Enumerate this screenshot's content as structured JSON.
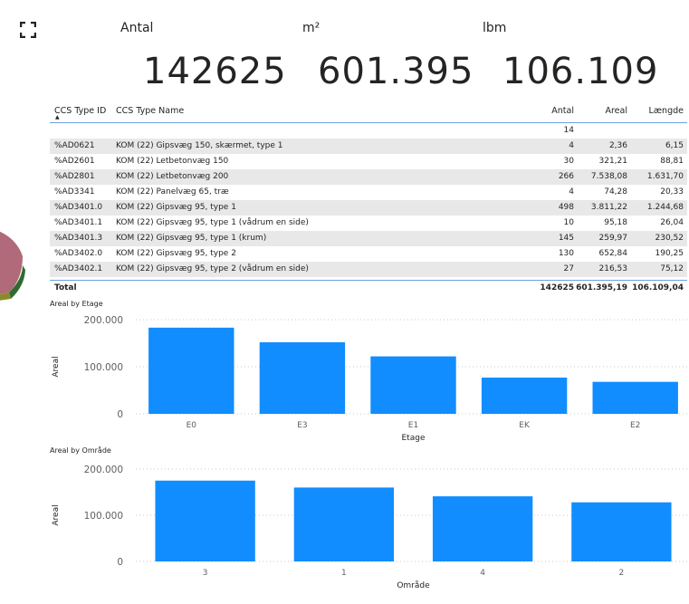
{
  "focus_icon": "focus-mode-icon",
  "kpis": [
    {
      "label": "Antal",
      "value": "142625"
    },
    {
      "label": "m²",
      "value": "601.395"
    },
    {
      "label": "lbm",
      "value": "106.109"
    }
  ],
  "table": {
    "headers": [
      "CCS Type ID",
      "CCS Type Name",
      "Antal",
      "Areal",
      "Længde"
    ],
    "rows": [
      [
        "",
        "",
        "14",
        "",
        ""
      ],
      [
        "%AD0621",
        "KOM (22) Gipsvæg 150, skærmet, type 1",
        "4",
        "2,36",
        "6,15"
      ],
      [
        "%AD2601",
        "KOM (22) Letbetonvæg 150",
        "30",
        "321,21",
        "88,81"
      ],
      [
        "%AD2801",
        "KOM (22) Letbetonvæg 200",
        "266",
        "7.538,08",
        "1.631,70"
      ],
      [
        "%AD3341",
        "KOM (22) Panelvæg 65, træ",
        "4",
        "74,28",
        "20,33"
      ],
      [
        "%AD3401.0",
        "KOM (22) Gipsvæg 95, type 1",
        "498",
        "3.811,22",
        "1.244,68"
      ],
      [
        "%AD3401.1",
        "KOM (22) Gipsvæg 95, type 1 (vådrum en side)",
        "10",
        "95,18",
        "26,04"
      ],
      [
        "%AD3401.3",
        "KOM (22) Gipsvæg 95, type 1 (krum)",
        "145",
        "259,97",
        "230,52"
      ],
      [
        "%AD3402.0",
        "KOM (22) Gipsvæg 95, type 2",
        "130",
        "652,84",
        "190,25"
      ],
      [
        "%AD3402.1",
        "KOM (22) Gipsvæg 95, type 2 (vådrum en side)",
        "27",
        "216,53",
        "75,12"
      ]
    ],
    "total": {
      "label": "Total",
      "antal": "142625",
      "areal": "601.395,19",
      "laengde": "106.109,04"
    }
  },
  "chart_data": [
    {
      "type": "bar",
      "title": "Areal by Etage",
      "xlabel": "Etage",
      "ylabel": "Areal",
      "categories": [
        "E0",
        "E3",
        "E1",
        "EK",
        "E2"
      ],
      "values": [
        183000,
        152000,
        122000,
        77000,
        68000
      ],
      "ylim": [
        0,
        200000
      ],
      "yticks": [
        "0",
        "100.000",
        "200.000"
      ],
      "grid": true,
      "color": "#118dff"
    },
    {
      "type": "bar",
      "title": "Areal by Område",
      "xlabel": "Område",
      "ylabel": "Areal",
      "categories": [
        "3",
        "1",
        "4",
        "2"
      ],
      "values": [
        175000,
        160000,
        141000,
        128000
      ],
      "ylim": [
        0,
        200000
      ],
      "yticks": [
        "0",
        "100.000",
        "200.000"
      ],
      "grid": true,
      "color": "#118dff"
    }
  ]
}
